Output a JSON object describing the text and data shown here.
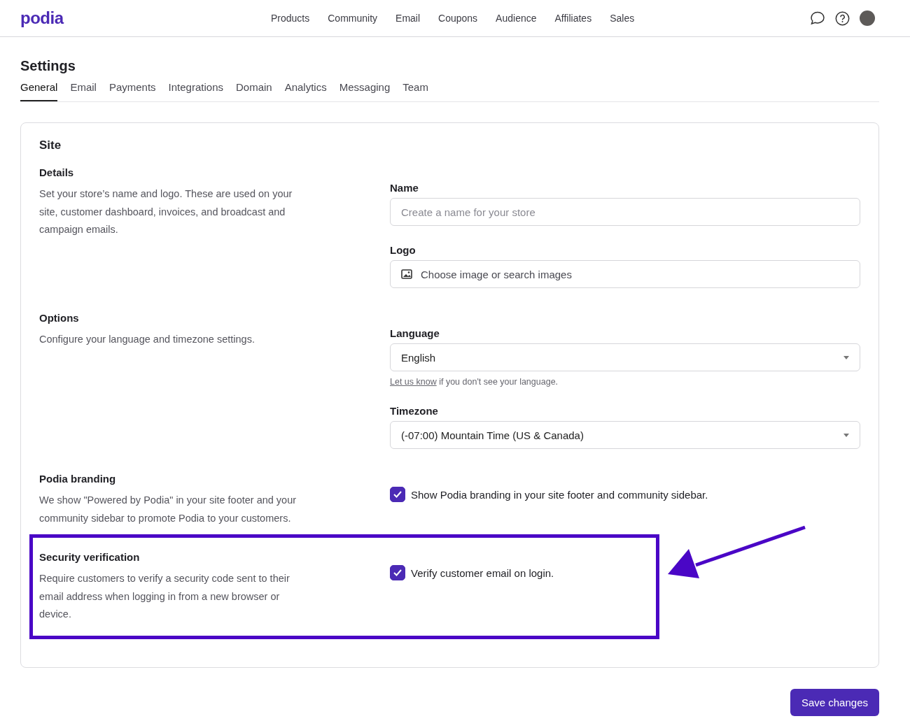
{
  "header": {
    "logo": "podia",
    "nav": [
      "Products",
      "Community",
      "Email",
      "Coupons",
      "Audience",
      "Affiliates",
      "Sales"
    ]
  },
  "page": {
    "title": "Settings",
    "tabs": [
      {
        "label": "General",
        "selected": true
      },
      {
        "label": "Email",
        "selected": false
      },
      {
        "label": "Payments",
        "selected": false
      },
      {
        "label": "Integrations",
        "selected": false
      },
      {
        "label": "Domain",
        "selected": false
      },
      {
        "label": "Analytics",
        "selected": false
      },
      {
        "label": "Messaging",
        "selected": false
      },
      {
        "label": "Team",
        "selected": false
      }
    ]
  },
  "card": {
    "title": "Site",
    "sections": [
      {
        "heading": "Details",
        "description": "Set your store’s name and logo. These are used on your site, customer dashboard, invoices, and broadcast and campaign emails.",
        "highlighted": false,
        "controls": [
          {
            "kind": "input",
            "label": "Name",
            "placeholder": "Create a name for your store"
          },
          {
            "kind": "picker",
            "label": "Logo",
            "value": "Choose image or search images"
          }
        ]
      },
      {
        "heading": "Options",
        "description": "Configure your language and timezone settings.",
        "highlighted": false,
        "controls": [
          {
            "kind": "select",
            "label": "Language",
            "value": "English",
            "help_link": "Let us know",
            "help": " if you don't see your language."
          },
          {
            "kind": "select",
            "label": "Timezone",
            "value": "(-07:00) Mountain Time (US & Canada)"
          }
        ]
      },
      {
        "heading": "Podia branding",
        "description": "We show \"Powered by Podia\" in your site footer and your community sidebar to promote Podia to your customers.",
        "highlighted": false,
        "controls": [
          {
            "kind": "checkbox",
            "label": "Show Podia branding in your site footer and community sidebar.",
            "checked": true
          }
        ]
      },
      {
        "heading": "Security verification",
        "description": "Require customers to verify a security code sent to their email address when logging in from a new browser or device.",
        "highlighted": true,
        "controls": [
          {
            "kind": "checkbox",
            "label": "Verify customer email on login.",
            "checked": true
          }
        ]
      }
    ]
  },
  "save_button": "Save changes"
}
